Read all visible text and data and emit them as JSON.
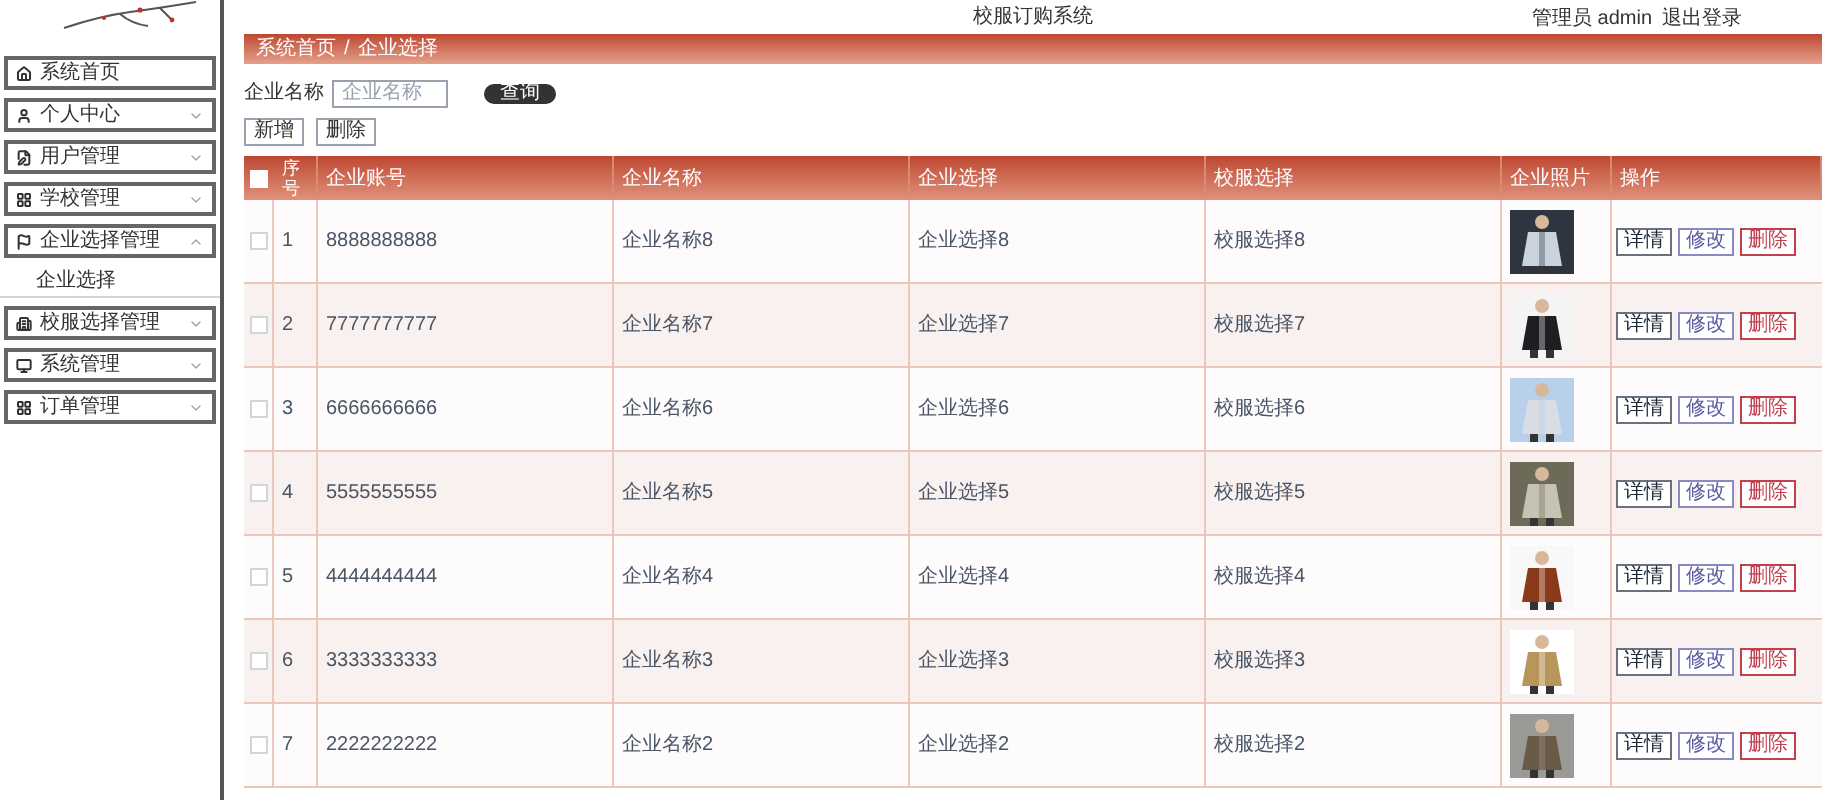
{
  "header": {
    "title": "校服订购系统",
    "user_label": "管理员 admin",
    "logout": "退出登录"
  },
  "sidebar": {
    "items": [
      {
        "label": "系统首页"
      },
      {
        "label": "个人中心",
        "expanded": false
      },
      {
        "label": "用户管理",
        "expanded": false
      },
      {
        "label": "学校管理",
        "expanded": false
      },
      {
        "label": "企业选择管理",
        "expanded": true,
        "children": [
          {
            "label": "企业选择"
          }
        ]
      },
      {
        "label": "校服选择管理",
        "expanded": false
      },
      {
        "label": "系统管理",
        "expanded": false
      },
      {
        "label": "订单管理",
        "expanded": false
      }
    ]
  },
  "breadcrumb": [
    "系统首页",
    "企业选择"
  ],
  "breadcrumb_separator": "/",
  "search": {
    "label": "企业名称",
    "placeholder": "企业名称",
    "button": "查询"
  },
  "toolbar": [
    "新增",
    "删除"
  ],
  "table": {
    "columns": [
      "序号",
      "企业账号",
      "企业名称",
      "企业选择",
      "校服选择",
      "企业照片",
      "操作"
    ],
    "header_checked": false,
    "rows": [
      {
        "checked": false,
        "index": "1",
        "account": "8888888888",
        "name": "企业名称8",
        "choice": "企业选择8",
        "uniform": "校服选择8",
        "actions": [
          "详情",
          "修改",
          "删除"
        ]
      },
      {
        "checked": false,
        "index": "2",
        "account": "7777777777",
        "name": "企业名称7",
        "choice": "企业选择7",
        "uniform": "校服选择7",
        "actions": [
          "详情",
          "修改",
          "删除"
        ]
      },
      {
        "checked": false,
        "index": "3",
        "account": "6666666666",
        "name": "企业名称6",
        "choice": "企业选择6",
        "uniform": "校服选择6",
        "actions": [
          "详情",
          "修改",
          "删除"
        ]
      },
      {
        "checked": false,
        "index": "4",
        "account": "5555555555",
        "name": "企业名称5",
        "choice": "企业选择5",
        "uniform": "校服选择5",
        "actions": [
          "详情",
          "修改",
          "删除"
        ]
      },
      {
        "checked": false,
        "index": "5",
        "account": "4444444444",
        "name": "企业名称4",
        "choice": "企业选择4",
        "uniform": "校服选择4",
        "actions": [
          "详情",
          "修改",
          "删除"
        ]
      },
      {
        "checked": false,
        "index": "6",
        "account": "3333333333",
        "name": "企业名称3",
        "choice": "企业选择3",
        "uniform": "校服选择3",
        "actions": [
          "详情",
          "修改",
          "删除"
        ]
      },
      {
        "checked": false,
        "index": "7",
        "account": "2222222222",
        "name": "企业名称2",
        "choice": "企业选择2",
        "uniform": "校服选择2",
        "actions": [
          "详情",
          "修改",
          "删除"
        ]
      }
    ]
  }
}
